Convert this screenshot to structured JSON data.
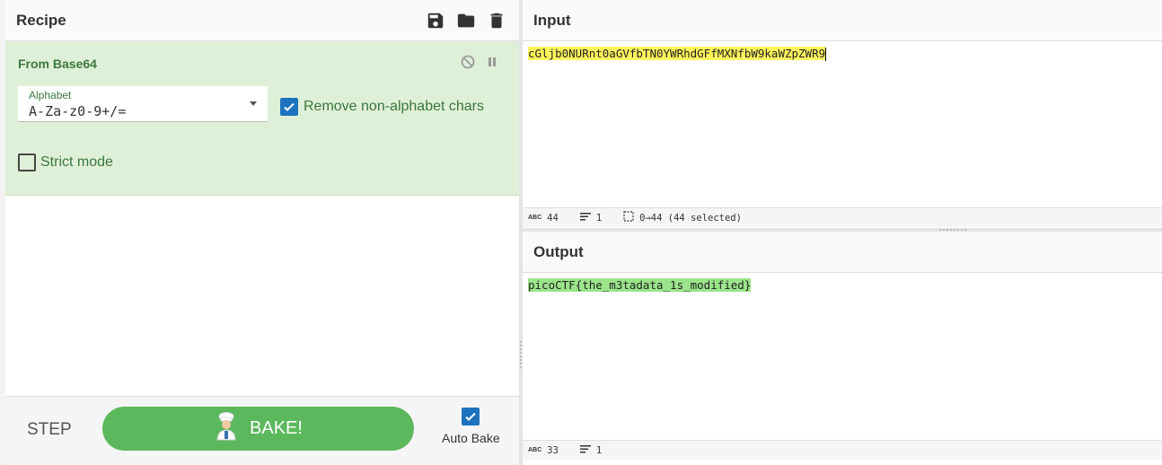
{
  "recipe": {
    "title": "Recipe",
    "operation": {
      "name": "From Base64",
      "alphabet_label": "Alphabet",
      "alphabet_value": "A-Za-z0-9+/=",
      "remove_non_alphabet_label": "Remove non-alphabet chars",
      "remove_non_alphabet_checked": true,
      "strict_mode_label": "Strict mode",
      "strict_mode_checked": false
    },
    "footer": {
      "step_label": "STEP",
      "bake_label": "BAKE!",
      "auto_bake_label": "Auto Bake",
      "auto_bake_checked": true
    },
    "icons": [
      "save-icon",
      "folder-icon",
      "trash-icon"
    ]
  },
  "input": {
    "title": "Input",
    "text": "cGljb0NURnt0aGVfbTN0YWRhdGFfMXNfbW9kaWZpZWR9",
    "status": {
      "length": "44",
      "lines": "1",
      "selection": "0→44 (44 selected)"
    }
  },
  "output": {
    "title": "Output",
    "text": "picoCTF{the_m3tadata_1s_modified}",
    "status": {
      "length": "33",
      "lines": "1"
    }
  },
  "colors": {
    "operation_bg": "#dff0d8",
    "operation_text": "#3c763d",
    "bake_button": "#5cb85c",
    "checkbox": "#1e73be",
    "input_highlight": "#fff35c",
    "output_highlight": "#9be48a"
  }
}
